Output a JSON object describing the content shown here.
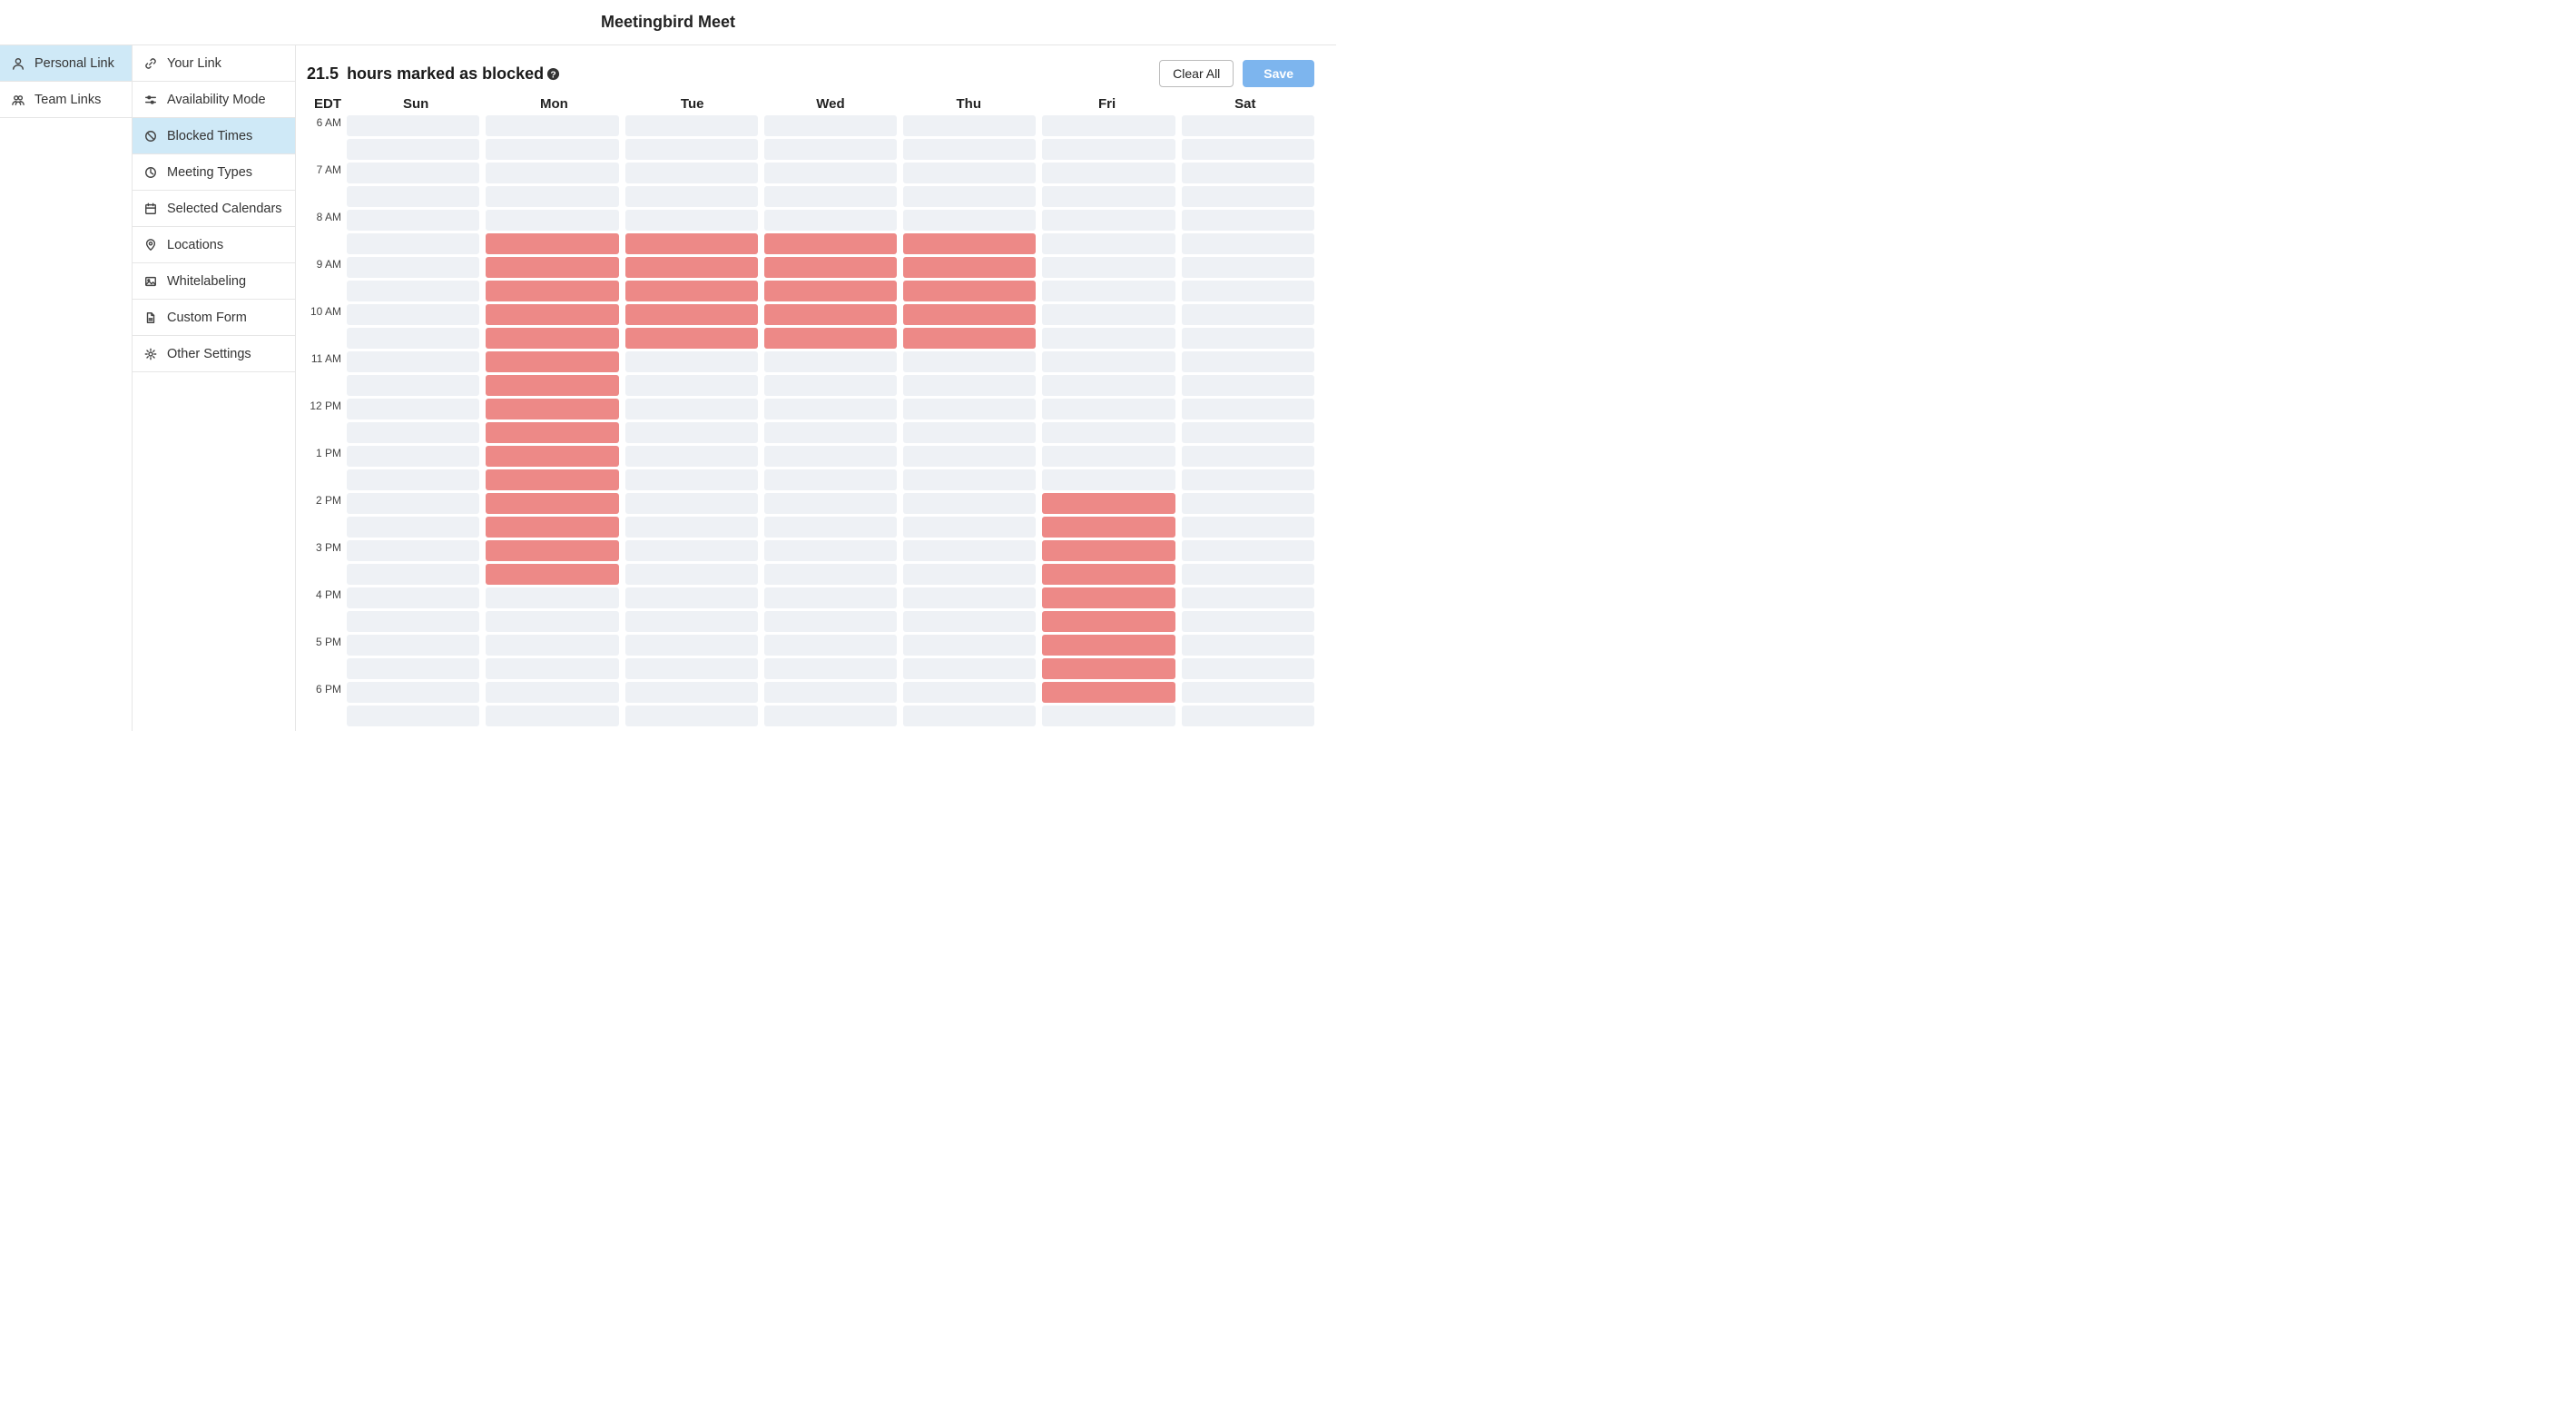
{
  "header": {
    "title": "Meetingbird Meet"
  },
  "left_nav": {
    "items": [
      {
        "label": "Personal Link",
        "icon": "user",
        "active": true
      },
      {
        "label": "Team Links",
        "icon": "users",
        "active": false
      }
    ]
  },
  "sub_nav": {
    "items": [
      {
        "label": "Your Link",
        "icon": "link",
        "active": false
      },
      {
        "label": "Availability Mode",
        "icon": "sliders",
        "active": false
      },
      {
        "label": "Blocked Times",
        "icon": "ban",
        "active": true
      },
      {
        "label": "Meeting Types",
        "icon": "clock",
        "active": false
      },
      {
        "label": "Selected Calendars",
        "icon": "calendar",
        "active": false
      },
      {
        "label": "Locations",
        "icon": "pin",
        "active": false
      },
      {
        "label": "Whitelabeling",
        "icon": "image",
        "active": false
      },
      {
        "label": "Custom Form",
        "icon": "file",
        "active": false
      },
      {
        "label": "Other Settings",
        "icon": "gear",
        "active": false
      }
    ]
  },
  "toolbar": {
    "summary_hours": "21.5",
    "summary_suffix": "hours marked as blocked",
    "clear_label": "Clear All",
    "save_label": "Save"
  },
  "schedule": {
    "timezone": "EDT",
    "days": [
      "Sun",
      "Mon",
      "Tue",
      "Wed",
      "Thu",
      "Fri",
      "Sat"
    ],
    "hours": [
      "6 AM",
      "7 AM",
      "8 AM",
      "9 AM",
      "10 AM",
      "11 AM",
      "12 PM",
      "1 PM",
      "2 PM",
      "3 PM",
      "4 PM",
      "5 PM",
      "6 PM"
    ],
    "blocked": {
      "Sun": [],
      "Mon": [
        "8:30",
        "9:00",
        "9:30",
        "10:00",
        "10:30",
        "11:00",
        "11:30",
        "12:00",
        "12:30",
        "13:00",
        "13:30",
        "14:00",
        "14:30",
        "15:00",
        "15:30"
      ],
      "Tue": [
        "8:30",
        "9:00",
        "9:30",
        "10:00",
        "10:30"
      ],
      "Wed": [
        "8:30",
        "9:00",
        "9:30",
        "10:00",
        "10:30"
      ],
      "Thu": [
        "8:30",
        "9:00",
        "9:30",
        "10:00",
        "10:30"
      ],
      "Fri": [
        "14:00",
        "14:30",
        "15:00",
        "15:30",
        "16:00",
        "16:30",
        "17:00",
        "17:30",
        "18:00"
      ],
      "Sat": []
    }
  },
  "colors": {
    "accent": "#7db5ee",
    "blocked": "#ed8987",
    "slot": "#eef1f5",
    "nav_active": "#cfe9f7"
  }
}
